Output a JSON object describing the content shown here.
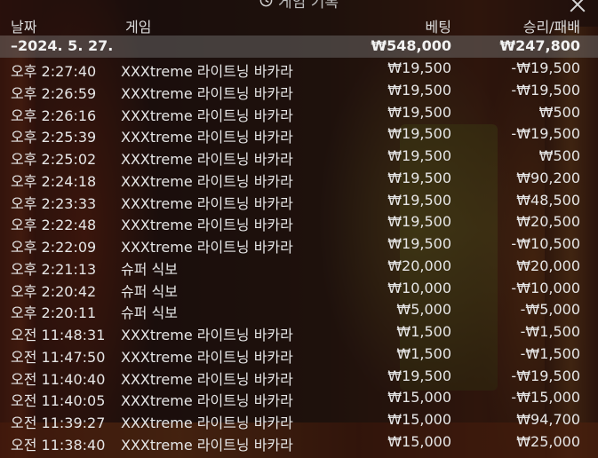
{
  "header": {
    "title": "게임 기록",
    "col_time": "날짜",
    "col_game": "게임",
    "col_bet": "베팅",
    "col_result": "승리/패배"
  },
  "date_group": {
    "date": "–2024. 5. 27.",
    "total_bet": "₩548,000",
    "total_result": "₩247,800"
  },
  "rows": [
    {
      "time": "오후 2:27:40",
      "game": "XXXtreme 라이트닝 바카라",
      "bet": "₩19,500",
      "result": "-₩19,500"
    },
    {
      "time": "오후 2:26:59",
      "game": "XXXtreme 라이트닝 바카라",
      "bet": "₩19,500",
      "result": "-₩19,500"
    },
    {
      "time": "오후 2:26:16",
      "game": "XXXtreme 라이트닝 바카라",
      "bet": "₩19,500",
      "result": "₩500"
    },
    {
      "time": "오후 2:25:39",
      "game": "XXXtreme 라이트닝 바카라",
      "bet": "₩19,500",
      "result": "-₩19,500"
    },
    {
      "time": "오후 2:25:02",
      "game": "XXXtreme 라이트닝 바카라",
      "bet": "₩19,500",
      "result": "₩500"
    },
    {
      "time": "오후 2:24:18",
      "game": "XXXtreme 라이트닝 바카라",
      "bet": "₩19,500",
      "result": "₩90,200"
    },
    {
      "time": "오후 2:23:33",
      "game": "XXXtreme 라이트닝 바카라",
      "bet": "₩19,500",
      "result": "₩48,500"
    },
    {
      "time": "오후 2:22:48",
      "game": "XXXtreme 라이트닝 바카라",
      "bet": "₩19,500",
      "result": "₩20,500"
    },
    {
      "time": "오후 2:22:09",
      "game": "XXXtreme 라이트닝 바카라",
      "bet": "₩19,500",
      "result": "-₩10,500"
    },
    {
      "time": "오후 2:21:13",
      "game": "슈퍼 식보",
      "bet": "₩20,000",
      "result": "₩20,000"
    },
    {
      "time": "오후 2:20:42",
      "game": "슈퍼 식보",
      "bet": "₩10,000",
      "result": "-₩10,000"
    },
    {
      "time": "오후 2:20:11",
      "game": "슈퍼 식보",
      "bet": "₩5,000",
      "result": "-₩5,000"
    },
    {
      "time": "오전 11:48:31",
      "game": "XXXtreme 라이트닝 바카라",
      "bet": "₩1,500",
      "result": "-₩1,500"
    },
    {
      "time": "오전 11:47:50",
      "game": "XXXtreme 라이트닝 바카라",
      "bet": "₩1,500",
      "result": "-₩1,500"
    },
    {
      "time": "오전 11:40:40",
      "game": "XXXtreme 라이트닝 바카라",
      "bet": "₩19,500",
      "result": "-₩19,500"
    },
    {
      "time": "오전 11:40:05",
      "game": "XXXtreme 라이트닝 바카라",
      "bet": "₩15,000",
      "result": "-₩15,000"
    },
    {
      "time": "오전 11:39:27",
      "game": "XXXtreme 라이트닝 바카라",
      "bet": "₩15,000",
      "result": "₩94,700"
    },
    {
      "time": "오전 11:38:40",
      "game": "XXXtreme 라이트닝 바카라",
      "bet": "₩15,000",
      "result": "₩25,000"
    }
  ]
}
